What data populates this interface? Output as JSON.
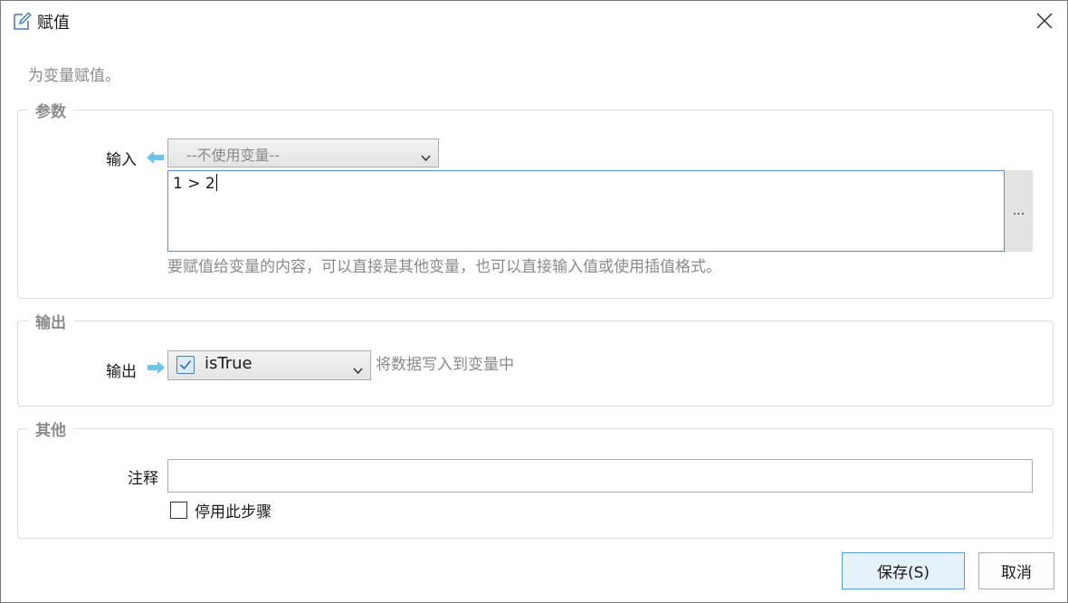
{
  "window": {
    "title": "赋值",
    "title_icon": "edit-icon",
    "close_icon": "close-icon"
  },
  "description": "为变量赋值。",
  "groups": {
    "params": {
      "title": "参数",
      "input_label": "输入",
      "variable_select": "--不使用变量--",
      "expression": "1 > 2",
      "ellipsis": "...",
      "hint": "要赋值给变量的内容，可以直接是其他变量，也可以直接输入值或使用插值格式。"
    },
    "output": {
      "title": "输出",
      "output_label": "输出",
      "variable_value": "isTrue",
      "variable_checked": true,
      "hint": "将数据写入到变量中"
    },
    "other": {
      "title": "其他",
      "comment_label": "注释",
      "comment_value": "",
      "disable_label": "停用此步骤",
      "disable_checked": false
    }
  },
  "buttons": {
    "save": "保存(S)",
    "cancel": "取消"
  },
  "colors": {
    "accent": "#4a90d9",
    "arrow": "#6cc4ee",
    "muted_text": "#8a8a8a",
    "primary_button_bg": "#e5f1fb"
  }
}
